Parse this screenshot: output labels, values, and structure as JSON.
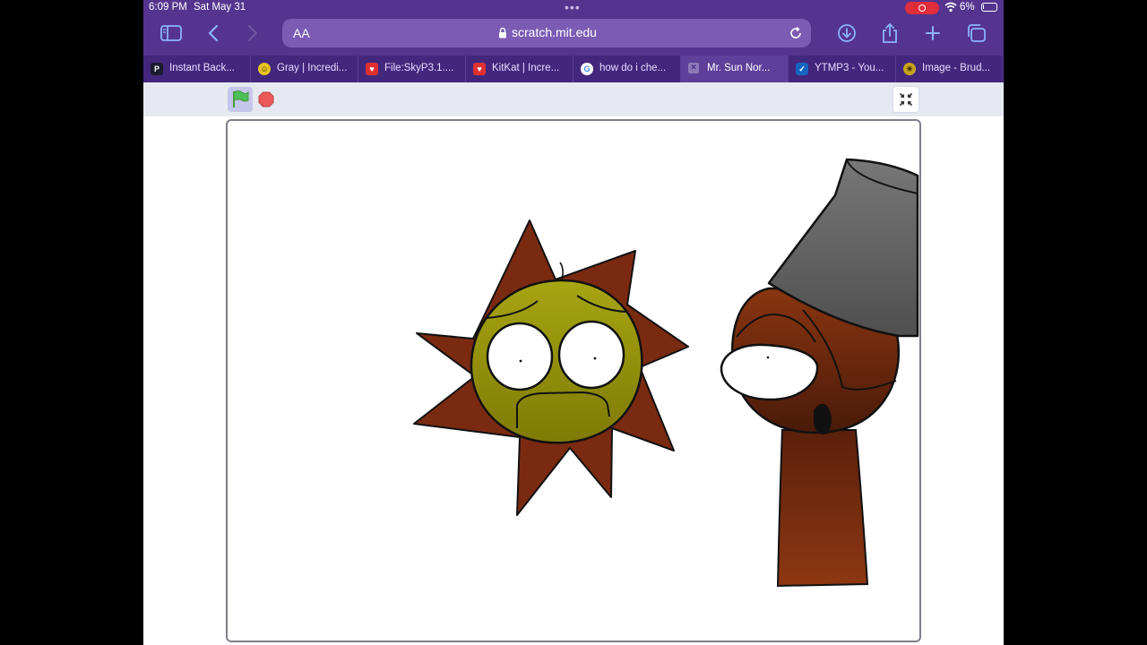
{
  "status_bar": {
    "time": "6:09 PM",
    "date": "Sat May 31",
    "battery_percent": "6%",
    "battery_level": 0.06,
    "screen_recording": true
  },
  "toolbar": {
    "text_size_label": "AA",
    "url": "scratch.mit.edu",
    "icons": [
      "sidebar-icon",
      "back-icon",
      "forward-icon",
      "reload-icon",
      "download-icon",
      "share-icon",
      "new-tab-icon",
      "tabs-overview-icon"
    ]
  },
  "tabs": [
    {
      "label": "Instant Back...",
      "favicon": "P",
      "favicon_color": "#1b1b2f",
      "active": false
    },
    {
      "label": "Gray | Incredi...",
      "favicon": "☺",
      "favicon_color": "#e8c21f",
      "active": false
    },
    {
      "label": "File:SkyP3.1....",
      "favicon": "♥",
      "favicon_color": "#e03131",
      "active": false
    },
    {
      "label": "KitKat | Incre...",
      "favicon": "♥",
      "favicon_color": "#e03131",
      "active": false
    },
    {
      "label": "how do i che...",
      "favicon": "G",
      "favicon_color": "#ffffff",
      "active": false
    },
    {
      "label": "Mr. Sun Nor...",
      "favicon": "×",
      "favicon_color": "#8d79b8",
      "active": true
    },
    {
      "label": "YTMP3 - You...",
      "favicon": "✓",
      "favicon_color": "#1565c0",
      "active": false
    },
    {
      "label": "Image - Brud...",
      "favicon": "☀",
      "favicon_color": "#c9a51a",
      "active": false
    }
  ],
  "stage_controls": {
    "icons": [
      "green-flag-icon",
      "stop-icon",
      "exit-fullscreen-icon"
    ]
  },
  "colors": {
    "toolbar_bg": "#55348f",
    "tabbar_bg": "#43277d",
    "sun_face": "#a2a20a",
    "spikes": "#7a2c12",
    "brown_character": "#7d2f10",
    "bucket": "#6b6b6b"
  }
}
